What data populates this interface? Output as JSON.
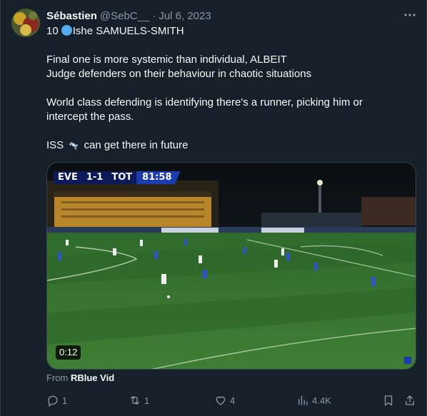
{
  "tweet": {
    "author_name": "Sébastien",
    "handle": "@SebC__",
    "separator": "·",
    "date": "Jul 6, 2023",
    "text": {
      "line1_prefix": "10",
      "line1_suffix": "Ishe SAMUELS-SMITH",
      "line2": "Final one is more systemic than individual, ALBEIT",
      "line3": "Judge defenders on their behaviour in chaotic situations",
      "line4": "World class defending is identifying there's a runner, picking him or",
      "line5": "intercept the pass.",
      "line6_prefix": "ISS",
      "line6_suffix": "can get there in future"
    },
    "media": {
      "duration": "0:12",
      "scorebug": {
        "home": "EVE",
        "score": "1-1",
        "away": "TOT",
        "clock": "81:58"
      },
      "source_label": "From",
      "source_name": "RBlue Vid"
    },
    "actions": {
      "replies": "1",
      "reposts": "1",
      "likes": "4",
      "views": "4.4K"
    }
  },
  "icons": {
    "more": "more-horizontal-icon",
    "reply": "reply-icon",
    "repost": "repost-icon",
    "like": "heart-icon",
    "views": "views-chart-icon",
    "bookmark": "bookmark-icon",
    "share": "share-icon",
    "flag": "blue-circle-emoji",
    "satellite": "satellite-emoji"
  },
  "colors": {
    "background": "#15202b",
    "text": "#f7f9f9",
    "secondary": "#8b98a5",
    "border": "#38444d"
  }
}
